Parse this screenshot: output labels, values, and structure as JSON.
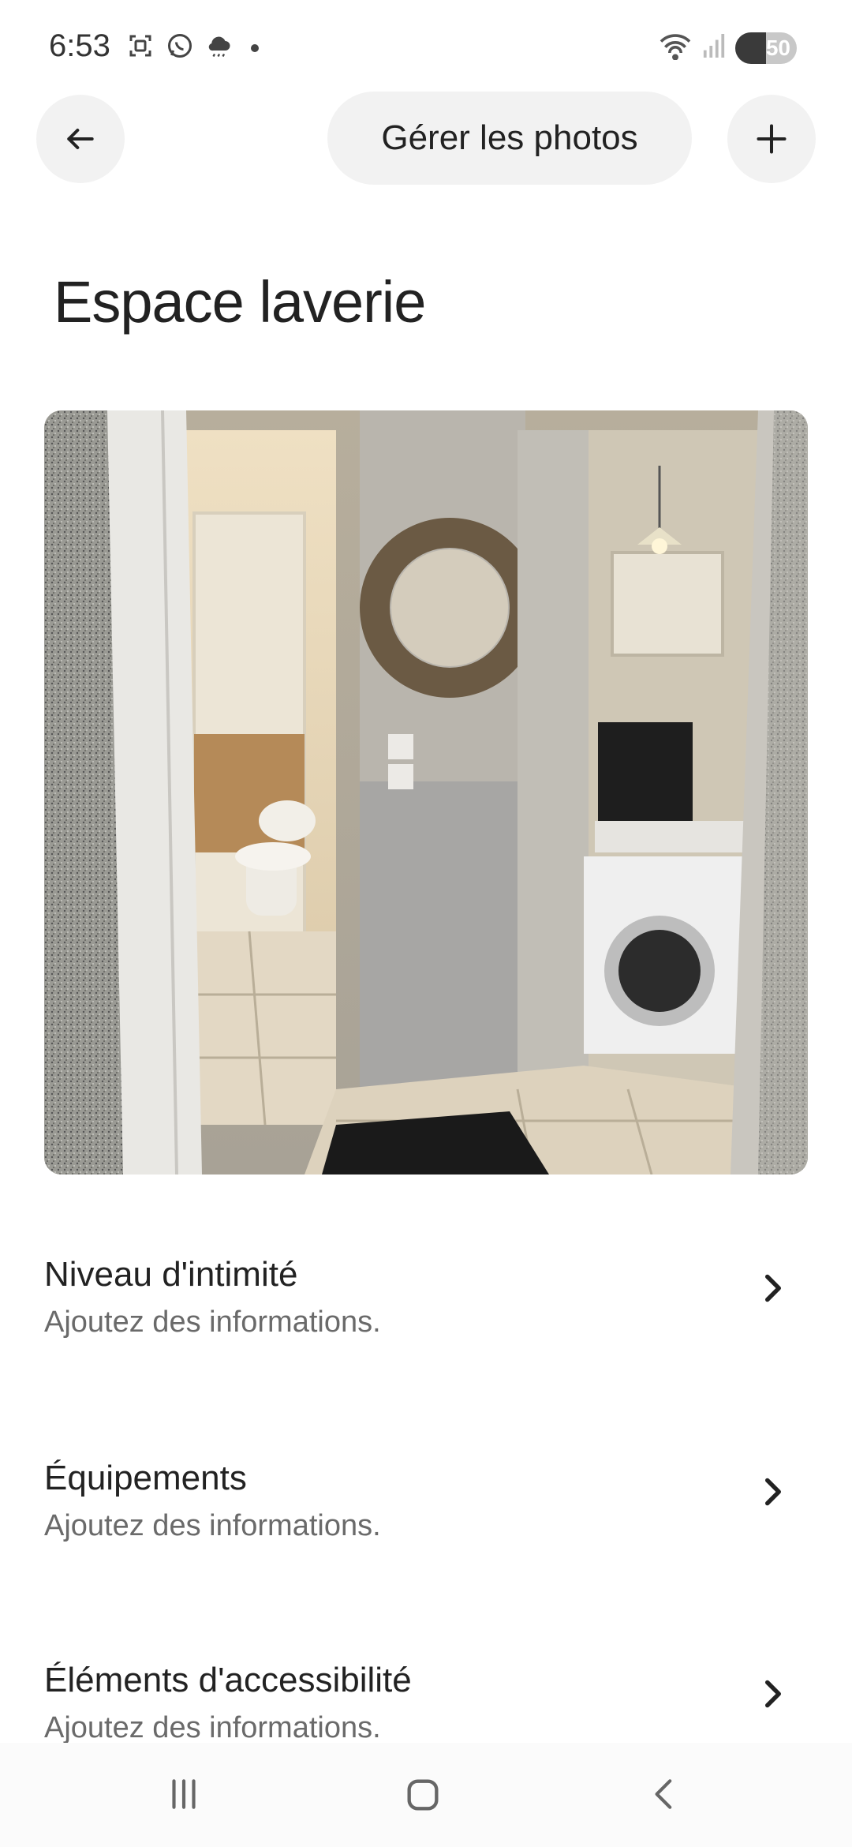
{
  "status_bar": {
    "time": "6:53",
    "battery": "50",
    "battery_level": 0.5,
    "icons_left": [
      "screenshot-icon",
      "whatsapp-icon",
      "weather-icon",
      "notification-dot"
    ],
    "icons_right": [
      "wifi-icon",
      "signal-icon",
      "battery-icon"
    ]
  },
  "header": {
    "manage_photos_label": "Gérer les photos",
    "back_icon": "arrow-left-icon",
    "add_icon": "plus-icon"
  },
  "page": {
    "title": "Espace laverie"
  },
  "photo": {
    "description_icon": "room-photo"
  },
  "list": [
    {
      "title": "Niveau d'intimité",
      "subtitle": "Ajoutez des informations."
    },
    {
      "title": "Équipements",
      "subtitle": "Ajoutez des informations."
    },
    {
      "title": "Éléments d'accessibilité",
      "subtitle": "Ajoutez des informations."
    }
  ],
  "colors": {
    "background": "#ffffff",
    "button_bg": "#f2f2f2",
    "text": "#222222",
    "subtext": "#6a6a6a"
  },
  "bottom_nav": {
    "icons": [
      "recent-apps-icon",
      "home-icon",
      "back-nav-icon"
    ]
  }
}
